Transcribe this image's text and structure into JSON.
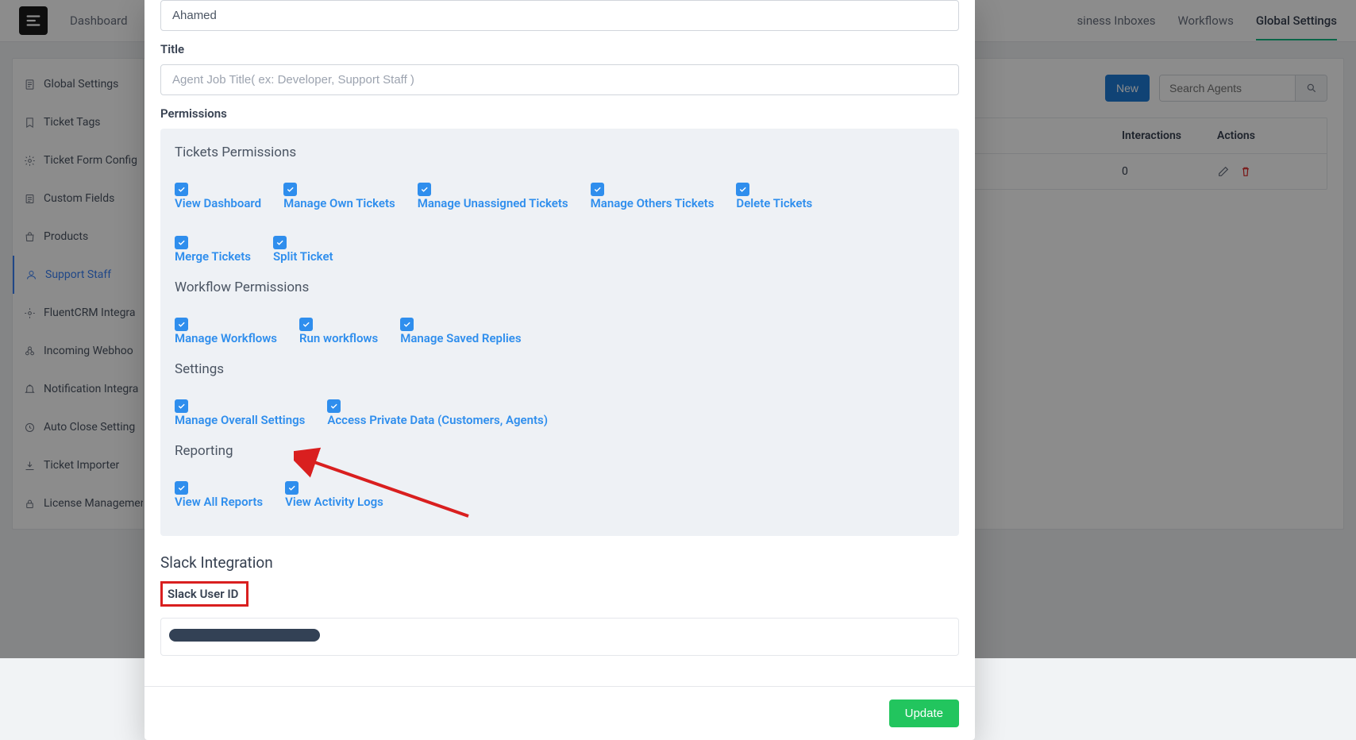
{
  "nav": {
    "dashboard": "Dashboard",
    "business_inboxes": "siness Inboxes",
    "workflows": "Workflows",
    "global_settings": "Global Settings"
  },
  "sidebar": {
    "global_settings": "Global Settings",
    "ticket_tags": "Ticket Tags",
    "ticket_form": "Ticket Form Config",
    "custom_fields": "Custom Fields",
    "products": "Products",
    "support_staff": "Support Staff",
    "fluentcrm": "FluentCRM Integra",
    "webhook": "Incoming Webhoo",
    "notification": "Notification Integra",
    "autoclose": "Auto Close Setting",
    "importer": "Ticket Importer",
    "license": "License Managemen"
  },
  "content": {
    "add_new": "New",
    "search_placeholder": "Search Agents",
    "col_interactions": "Interactions",
    "col_actions": "Actions",
    "row_interactions": "0"
  },
  "modal": {
    "name_value": "Ahamed",
    "title_label": "Title",
    "title_placeholder": "Agent Job Title( ex: Developer, Support Staff )",
    "permissions_label": "Permissions",
    "groups": {
      "tickets": "Tickets Permissions",
      "workflow": "Workflow Permissions",
      "settings": "Settings",
      "reporting": "Reporting"
    },
    "perms": {
      "view_dashboard": "View Dashboard",
      "manage_own": "Manage Own Tickets",
      "manage_unassigned": "Manage Unassigned Tickets",
      "manage_others": "Manage Others Tickets",
      "delete_tickets": "Delete Tickets",
      "merge_tickets": "Merge Tickets",
      "split_ticket": "Split Ticket",
      "manage_workflows": "Manage Workflows",
      "run_workflows": "Run workflows",
      "manage_replies": "Manage Saved Replies",
      "manage_settings": "Manage Overall Settings",
      "access_private": "Access Private Data (Customers, Agents)",
      "view_reports": "View All Reports",
      "view_activity": "View Activity Logs"
    },
    "slack_heading": "Slack Integration",
    "slack_label": "Slack User ID",
    "update_btn": "Update"
  }
}
